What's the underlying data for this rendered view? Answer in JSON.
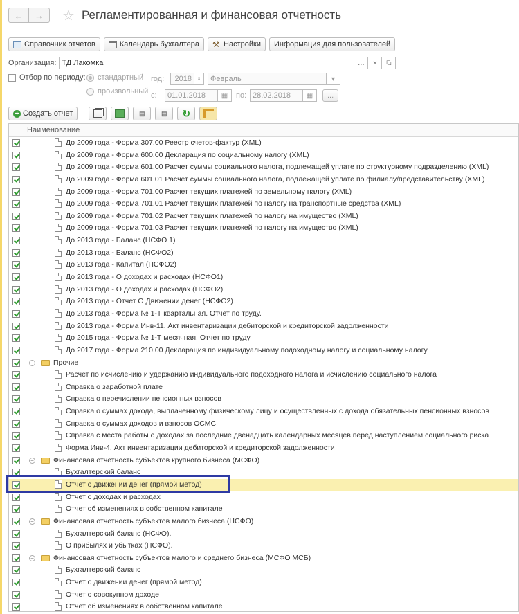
{
  "window": {
    "title": "Регламентированная и финансовая отчетность"
  },
  "toolbar": {
    "buttons": [
      "Справочник отчетов",
      "Календарь бухгалтера",
      "Настройки",
      "Информация для пользователей"
    ]
  },
  "filters": {
    "org_label": "Организация:",
    "org_value": "ТД Лакомка",
    "period_checkbox": "Отбор по периоду:",
    "radio_standard": "стандартный",
    "radio_arbitrary": "произвольный",
    "year_label": "год:",
    "year_value": "2018",
    "month_value": "Февраль",
    "from_label": "с:",
    "from_value": "01.01.2018",
    "to_label": "по:",
    "to_value": "28.02.2018",
    "more_btn": "..."
  },
  "actions": {
    "create_label": "Создать отчет"
  },
  "table": {
    "header": "Наименование",
    "rows": [
      {
        "text": "До 2009 года - Форма 307.00 Реестр счетов-фактур (XML)",
        "level": 2,
        "kind": "doc"
      },
      {
        "text": "До 2009 года - Форма 600.00 Декларация по социальному налогу (XML)",
        "level": 2,
        "kind": "doc"
      },
      {
        "text": "До 2009 года - Форма 601.00 Расчет суммы социального налога, подлежащей уплате по структурному подразделению (XML)",
        "level": 2,
        "kind": "doc"
      },
      {
        "text": "До 2009 года - Форма 601.01 Расчет суммы социального налога, подлежащей уплате по филиалу/представительству (XML)",
        "level": 2,
        "kind": "doc"
      },
      {
        "text": "До 2009 года - Форма 701.00 Расчет текущих платежей по земельному налогу (XML)",
        "level": 2,
        "kind": "doc"
      },
      {
        "text": "До 2009 года - Форма 701.01 Расчет текущих платежей по налогу на транспортные средства (XML)",
        "level": 2,
        "kind": "doc"
      },
      {
        "text": "До 2009 года - Форма 701.02 Расчет текущих платежей по налогу на имущество (XML)",
        "level": 2,
        "kind": "doc"
      },
      {
        "text": "До 2009 года - Форма 701.03 Расчет текущих платежей по налогу на имущество (XML)",
        "level": 2,
        "kind": "doc"
      },
      {
        "text": "До 2013 года - Баланс (НСФО 1)",
        "level": 2,
        "kind": "doc"
      },
      {
        "text": "До 2013 года - Баланс (НСФО2)",
        "level": 2,
        "kind": "doc"
      },
      {
        "text": "До 2013 года - Капитал (НСФО2)",
        "level": 2,
        "kind": "doc"
      },
      {
        "text": "До 2013 года - О доходах и расходах (НСФО1)",
        "level": 2,
        "kind": "doc"
      },
      {
        "text": "До 2013 года - О доходах и расходах (НСФО2)",
        "level": 2,
        "kind": "doc"
      },
      {
        "text": "До 2013 года - Отчет О Движении денег (НСФО2)",
        "level": 2,
        "kind": "doc"
      },
      {
        "text": "До 2013 года - Форма № 1-Т квартальная. Отчет по труду.",
        "level": 2,
        "kind": "doc"
      },
      {
        "text": "До 2013 года - Форма Инв-11. Акт инвентаризации дебиторской и кредиторской задолженности",
        "level": 2,
        "kind": "doc"
      },
      {
        "text": "До 2015 года - Форма № 1-Т месячная. Отчет по труду",
        "level": 2,
        "kind": "doc"
      },
      {
        "text": "До 2017 года - Форма 210.00 Декларация по индивидуальному подоходному налогу и социальному налогу",
        "level": 2,
        "kind": "doc"
      },
      {
        "text": "Прочие",
        "level": 1,
        "kind": "folder"
      },
      {
        "text": "Расчет по исчислению и удержанию индивидуального подоходного налога и исчислению социального налога",
        "level": 2,
        "kind": "doc"
      },
      {
        "text": "Справка о заработной плате",
        "level": 2,
        "kind": "doc"
      },
      {
        "text": "Справка о перечислении пенсионных взносов",
        "level": 2,
        "kind": "doc"
      },
      {
        "text": "Справка о суммах дохода, выплаченному физическому лицу и осуществленных с дохода обязательных пенсионных взносов",
        "level": 2,
        "kind": "doc"
      },
      {
        "text": "Справка о суммах доходов и взносов ОСМС",
        "level": 2,
        "kind": "doc"
      },
      {
        "text": "Справка с места работы о доходах за последние двенадцать календарных месяцев перед наступлением социального риска",
        "level": 2,
        "kind": "doc"
      },
      {
        "text": "Форма Инв-4. Акт инвентаризации дебиторской и кредиторской задолженности",
        "level": 2,
        "kind": "doc"
      },
      {
        "text": "Финансовая отчетность субъектов крупного бизнеса (МСФО)",
        "level": 1,
        "kind": "folder"
      },
      {
        "text": "Бухгалтерский баланс",
        "level": 2,
        "kind": "doc"
      },
      {
        "text": "Отчет о движении денег (прямой метод)",
        "level": 2,
        "kind": "doc",
        "selected": true
      },
      {
        "text": "Отчет о доходах и расходах",
        "level": 2,
        "kind": "doc"
      },
      {
        "text": "Отчет об изменениях в собственном капитале",
        "level": 2,
        "kind": "doc"
      },
      {
        "text": "Финансовая отчетность субъектов малого бизнеса (НСФО)",
        "level": 1,
        "kind": "folder"
      },
      {
        "text": "Бухгалтерский баланс (НСФО).",
        "level": 2,
        "kind": "doc"
      },
      {
        "text": "О прибылях и убытках (НСФО).",
        "level": 2,
        "kind": "doc"
      },
      {
        "text": "Финансовая отчетность субъектов малого и среднего бизнеса (МСФО МСБ)",
        "level": 1,
        "kind": "folder"
      },
      {
        "text": "Бухгалтерский баланс",
        "level": 2,
        "kind": "doc"
      },
      {
        "text": "Отчет о движении денег (прямой метод)",
        "level": 2,
        "kind": "doc"
      },
      {
        "text": "Отчет о совокупном доходе",
        "level": 2,
        "kind": "doc"
      },
      {
        "text": "Отчет об изменениях в собственном капитале",
        "level": 2,
        "kind": "doc"
      }
    ]
  },
  "colors": {
    "accent": "#2e3aa3",
    "selection": "#faf0b0",
    "check": "#2e9b2e",
    "folder": "#f3cf63"
  }
}
